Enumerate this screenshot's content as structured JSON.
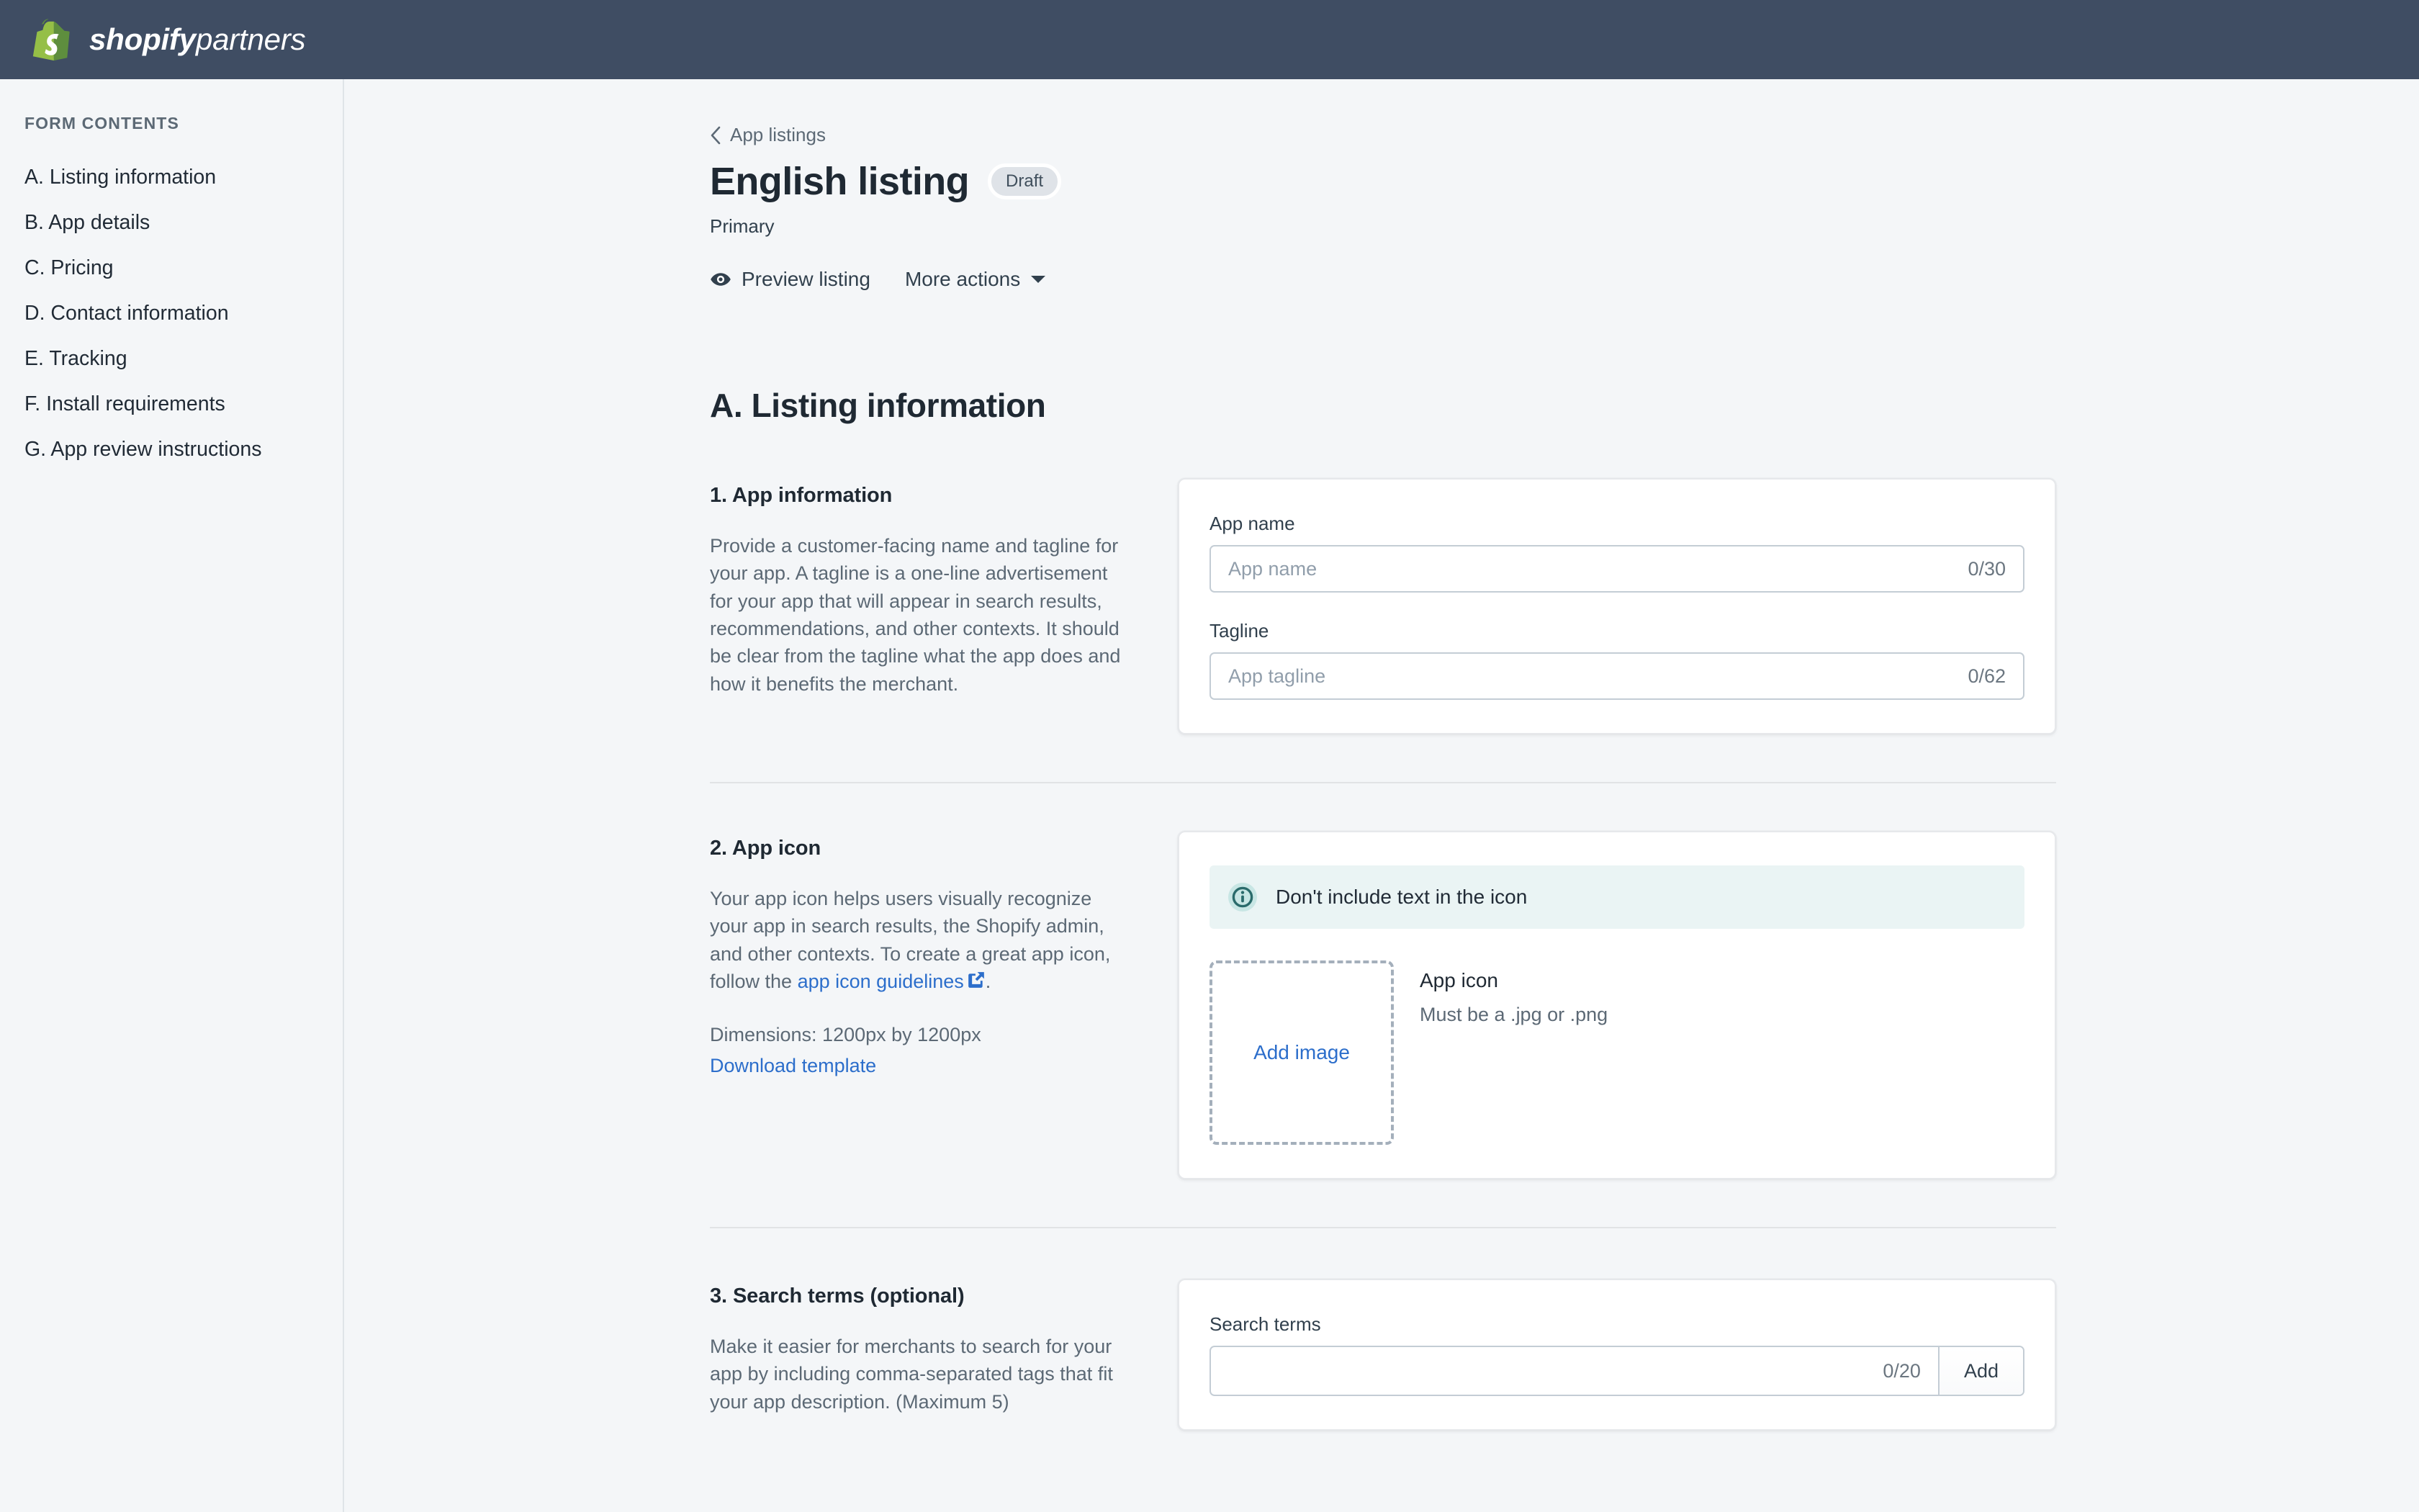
{
  "brand": {
    "name_bold": "shopify",
    "name_light": "partners",
    "logo_icon": "shopify-bag-icon",
    "bar_color": "#3f4d63",
    "logo_green": "#95bf47"
  },
  "sidebar": {
    "heading": "FORM CONTENTS",
    "items": [
      {
        "label": "A. Listing information"
      },
      {
        "label": "B. App details"
      },
      {
        "label": "C. Pricing"
      },
      {
        "label": "D. Contact information"
      },
      {
        "label": "E. Tracking"
      },
      {
        "label": "F. Install requirements"
      },
      {
        "label": "G. App review instructions"
      }
    ]
  },
  "header": {
    "breadcrumb": "App listings",
    "breadcrumb_icon": "chevron-left-icon",
    "title": "English listing",
    "badge": "Draft",
    "subtitle": "Primary",
    "actions": [
      {
        "label": "Preview listing",
        "icon": "eye-icon"
      },
      {
        "label": "More actions",
        "icon": "chevron-down-icon"
      }
    ]
  },
  "section": {
    "title": "A. Listing information"
  },
  "app_information": {
    "number_title": "1. App information",
    "description": "Provide a customer-facing name and tagline for your app. A tagline is a one-line advertisement for your app that will appear in search results, recommendations, and other contexts. It should be clear from the tagline what the app does and how it benefits the merchant.",
    "fields": [
      {
        "label": "App name",
        "placeholder": "App name",
        "value": "",
        "counter": "0/30"
      },
      {
        "label": "Tagline",
        "placeholder": "App tagline",
        "value": "",
        "counter": "0/62"
      }
    ]
  },
  "app_icon": {
    "number_title": "2. App icon",
    "description_before_link": "Your app icon helps users visually recognize your app in search results, the Shopify admin, and other contexts. To create a great app icon, follow the ",
    "link_text": "app icon guidelines",
    "link_icon": "external-link-icon",
    "description_after_link": ".",
    "dimensions": "Dimensions: 1200px by 1200px",
    "download_link": "Download template",
    "banner": {
      "icon": "info-circle-icon",
      "text": "Don't include text in the icon",
      "background": "#eaf4f4",
      "icon_color": "#2a6b6b"
    },
    "dropzone_label": "Add image",
    "meta_title": "App icon",
    "meta_subtitle": "Must be a .jpg or .png"
  },
  "search_terms": {
    "number_title": "3. Search terms (optional)",
    "description": "Make it easier for merchants to search for your app by including comma-separated tags that fit your app description. (Maximum 5)",
    "field_label": "Search terms",
    "placeholder": "",
    "value": "",
    "counter": "0/20",
    "add_button": "Add"
  },
  "colors": {
    "link": "#2c6ecb",
    "text_dark": "#1f2933",
    "text_muted": "#5c6975",
    "page_bg": "#f4f6f8"
  }
}
